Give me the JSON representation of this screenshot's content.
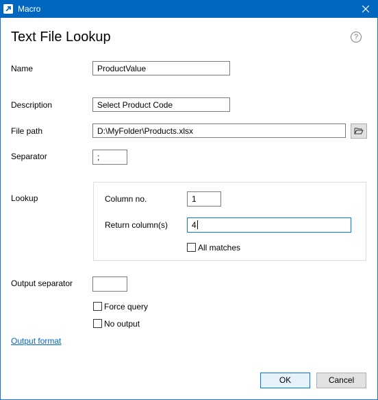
{
  "window": {
    "title": "Macro"
  },
  "dialog": {
    "heading": "Text File Lookup"
  },
  "fields": {
    "name": {
      "label": "Name",
      "value": "ProductValue"
    },
    "description": {
      "label": "Description",
      "value": "Select Product Code"
    },
    "file_path": {
      "label": "File path",
      "value": "D:\\MyFolder\\Products.xlsx"
    },
    "separator": {
      "label": "Separator",
      "value": ";"
    }
  },
  "lookup": {
    "label": "Lookup",
    "column_no": {
      "label": "Column no.",
      "value": "1"
    },
    "return_columns": {
      "label": "Return column(s)",
      "value": "4"
    },
    "all_matches": {
      "label": "All matches",
      "checked": false
    }
  },
  "output": {
    "separator_label": "Output separator",
    "separator_value": "",
    "force_query": {
      "label": "Force query",
      "checked": false
    },
    "no_output": {
      "label": "No output",
      "checked": false
    },
    "format_link": "Output format"
  },
  "buttons": {
    "ok": "OK",
    "cancel": "Cancel"
  },
  "icons": {
    "help": "?"
  },
  "colors": {
    "titlebar": "#0067c0",
    "link": "#0066cc",
    "focus": "#0078d7"
  }
}
